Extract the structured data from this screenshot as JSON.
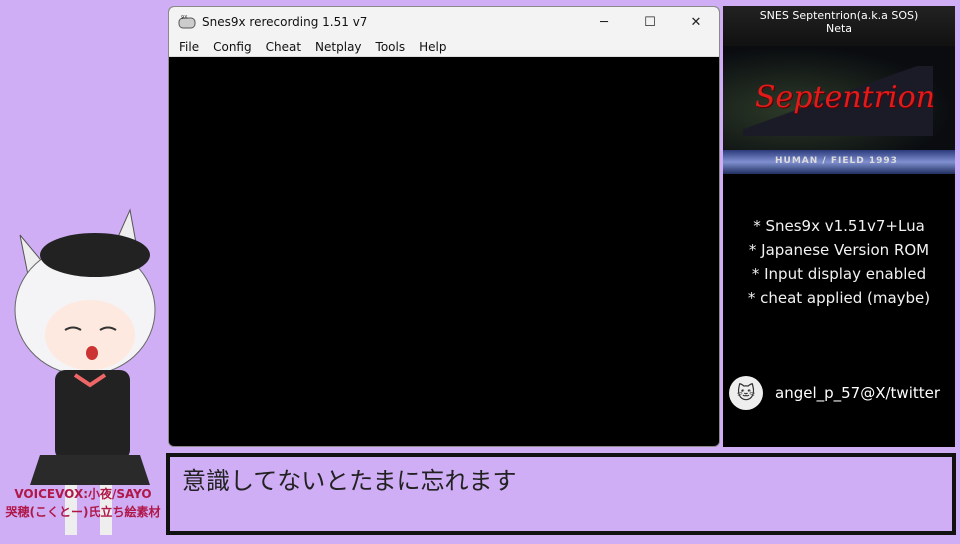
{
  "window": {
    "title": "Snes9x rerecording 1.51 v7",
    "minimize": "─",
    "maximize": "☐",
    "close": "✕",
    "menu": [
      "File",
      "Config",
      "Cheat",
      "Netplay",
      "Tools",
      "Help"
    ]
  },
  "side": {
    "title": "SNES Septentrion(a.k.a SOS)",
    "subtitle": "Neta",
    "logo": "Septentrion",
    "credit": "HUMAN / FIELD 1993",
    "notes": [
      "* Snes9x v1.51v7+Lua",
      "* Japanese Version ROM",
      "* Input display enabled",
      "* cheat applied (maybe)"
    ],
    "twitter": "angel_p_57@X/twitter"
  },
  "subtitle": "意識してないとたまに忘れます",
  "credits": [
    "VOICEVOX:小夜/SAYO",
    "哭穂(こくとー)氏立ち絵素材"
  ]
}
